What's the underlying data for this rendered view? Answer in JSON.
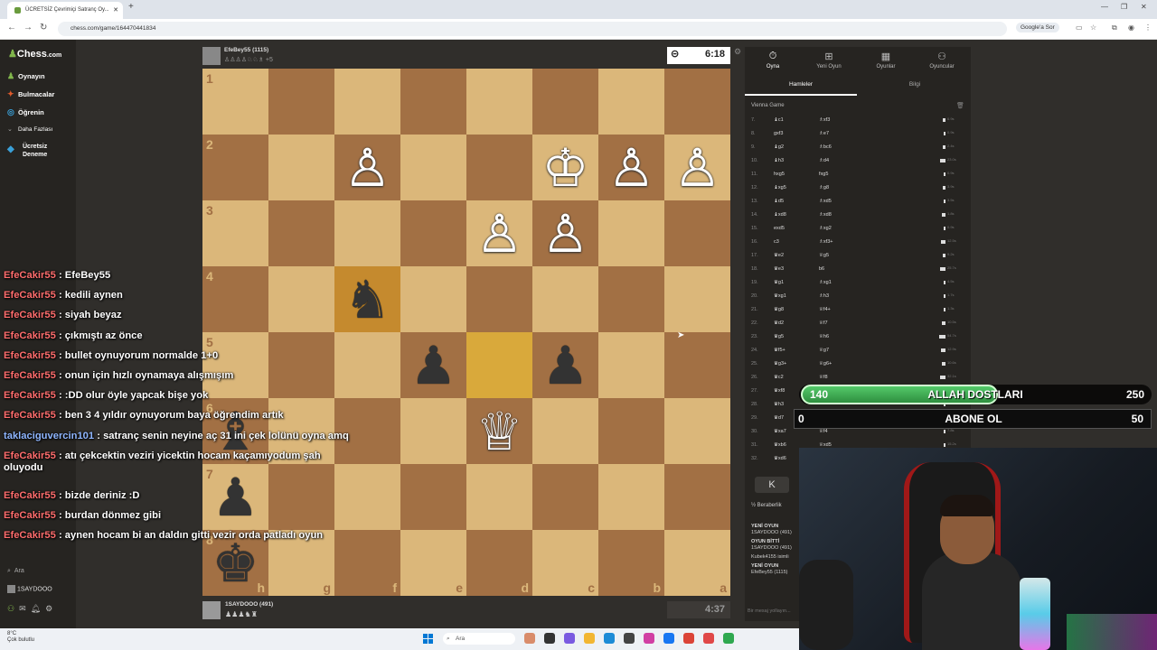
{
  "browser": {
    "tab_title": "ÜCRETSİZ Çevrimiçi Satranç Oy...",
    "url": "chess.com/game/164470441834",
    "google_sor": "Google'a Sor"
  },
  "sidebar": {
    "logo": "Chess",
    "logo_suffix": ".com",
    "items": [
      {
        "label": "Oynayın",
        "icon": "play-icon",
        "color": "#81b64c"
      },
      {
        "label": "Bulmacalar",
        "icon": "puzzle-icon",
        "color": "#e05a2b"
      },
      {
        "label": "Öğrenin",
        "icon": "learn-icon",
        "color": "#3aa0d8"
      },
      {
        "label": "Daha Fazlası",
        "icon": "chevron-down-icon",
        "color": "#aaa"
      }
    ],
    "trial_line1": "Ücretsiz",
    "trial_line2": "Deneme",
    "search": "Ara",
    "user": "1SAYDOOO"
  },
  "game": {
    "top_player": {
      "name": "EfeBey55 (1115)",
      "captured": "♙♙♙♙♘♘♗ +5"
    },
    "top_clock": "6:18",
    "bottom_player": {
      "name": "1SAYDOOO (491)",
      "captured": "♟♟♟♞♜"
    },
    "bottom_clock": "4:37",
    "ranks": [
      "1",
      "2",
      "3",
      "4",
      "5",
      "6",
      "7",
      "8"
    ],
    "files": [
      "h",
      "g",
      "f",
      "e",
      "d",
      "c",
      "b",
      "a"
    ],
    "pieces": {
      "1,2": {
        "g": "♙",
        "c": "w"
      },
      "1,5": {
        "g": "♔",
        "c": "w"
      },
      "1,6": {
        "g": "♙",
        "c": "w"
      },
      "1,7": {
        "g": "♙",
        "c": "w"
      },
      "2,4": {
        "g": "♙",
        "c": "w"
      },
      "2,5": {
        "g": "♙",
        "c": "w"
      },
      "3,2": {
        "g": "♞",
        "c": "b"
      },
      "4,3": {
        "g": "♟",
        "c": "b"
      },
      "4,5": {
        "g": "♟",
        "c": "b"
      },
      "5,0": {
        "g": "♝",
        "c": "b"
      },
      "5,4": {
        "g": "♕",
        "c": "w"
      },
      "6,0": {
        "g": "♟",
        "c": "b"
      },
      "7,0": {
        "g": "♚",
        "c": "b"
      }
    },
    "highlights": {
      "3,2": "hl",
      "4,4": "hl"
    }
  },
  "chat": [
    {
      "user": "EfeCakir55",
      "msg": " : EfeBey55",
      "utype": "red"
    },
    {
      "user": "EfeCakir55",
      "msg": " : kedili aynen",
      "utype": "red"
    },
    {
      "user": "EfeCakir55",
      "msg": " : siyah beyaz",
      "utype": "red"
    },
    {
      "user": "EfeCakir55",
      "msg": " : çıkmıştı az önce",
      "utype": "red"
    },
    {
      "user": "EfeCakir55",
      "msg": " : bullet oynuyorum normalde 1+0",
      "utype": "red"
    },
    {
      "user": "EfeCakir55",
      "msg": " : onun için hızlı oynamaya alışmışım",
      "utype": "red"
    },
    {
      "user": "EfeCakir55",
      "msg": " : :DD olur öyle yapcak bişe yok",
      "utype": "red"
    },
    {
      "user": "EfeCakir55",
      "msg": " : ben 3 4 yıldır oynuyorum baya öğrendim artık",
      "utype": "red"
    },
    {
      "user": "taklaciguvercin101",
      "msg": " : satranç senin neyine aç 31 ini çek lolünü oyna amq",
      "utype": "blue"
    },
    {
      "user": "EfeCakir55",
      "msg": " : atı çekcektin veziri yicektin hocam kaçamıyodum şah",
      "utype": "red"
    },
    {
      "user": "EfeCakir55",
      "msg": " : bizde deriniz :D",
      "utype": "red"
    },
    {
      "user": "EfeCakir55",
      "msg": " : burdan dönmez gibi",
      "utype": "red"
    },
    {
      "user": "EfeCakir55",
      "msg": " : aynen hocam bi an daldın gitti vezir orda patladı oyun",
      "utype": "red"
    }
  ],
  "chat_wrap": "oluyodu",
  "panel": {
    "tabs": [
      {
        "label": "Oyna",
        "icon": "clock-icon"
      },
      {
        "label": "Yeni Oyun",
        "icon": "plus-icon"
      },
      {
        "label": "Oyunlar",
        "icon": "grid-icon"
      },
      {
        "label": "Oyuncular",
        "icon": "players-icon"
      }
    ],
    "subtabs": [
      "Hamleler",
      "Bilgi"
    ],
    "opening": "Vienna Game",
    "moves": [
      {
        "n": "7.",
        "w": "♝c1",
        "b": "♗xf3",
        "t1": "6.9s",
        "t2": "7.6s",
        "bar": 3
      },
      {
        "n": "8.",
        "w": "gxf3",
        "b": "♗e7",
        "t1": "0.9s",
        "t2": "4.8s",
        "bar": 2
      },
      {
        "n": "9.",
        "w": "♝g2",
        "b": "♗bc6",
        "t1": "2.4s",
        "t2": "4.6s",
        "bar": 3
      },
      {
        "n": "10.",
        "w": "♝h3",
        "b": "♗d4",
        "t1": "23.0s",
        "t2": "11.0s",
        "bar": 6
      },
      {
        "n": "11.",
        "w": "hxg5",
        "b": "fxg5",
        "t1": "0.9s",
        "t2": "3.6s",
        "bar": 2
      },
      {
        "n": "12.",
        "w": "♝xg5",
        "b": "♗g8",
        "t1": "3.9s",
        "t2": "11.5s",
        "bar": 3
      },
      {
        "n": "13.",
        "w": "♝d5",
        "b": "♗xd5",
        "t1": "3.5s",
        "t2": "3.1s",
        "bar": 2
      },
      {
        "n": "14.",
        "w": "♝xd8",
        "b": "♗xd8",
        "t1": "1.8s",
        "t2": "17.8s",
        "bar": 4
      },
      {
        "n": "15.",
        "w": "exd5",
        "b": "♗xg2",
        "t1": "0.9s",
        "t2": "3.6s",
        "bar": 2
      },
      {
        "n": "16.",
        "w": "c3",
        "b": "♗xf3+",
        "t1": "12.5s",
        "t2": "4.2s",
        "bar": 5
      },
      {
        "n": "17.",
        "w": "♛e2",
        "b": "♕g5",
        "t1": "9.2s",
        "t2": "44.0s",
        "bar": 3
      },
      {
        "n": "18.",
        "w": "♛e3",
        "b": "b6",
        "t1": "25.7s",
        "t2": "2.7s",
        "bar": 6
      },
      {
        "n": "19.",
        "w": "♛g1",
        "b": "♗xg1",
        "t1": "4.5s",
        "t2": "17.5s",
        "bar": 2
      },
      {
        "n": "20.",
        "w": "♛xg1",
        "b": "♗h3",
        "t1": "1.7s",
        "t2": "4.6s",
        "bar": 2
      },
      {
        "n": "21.",
        "w": "♛g8",
        "b": "♕f4+",
        "t1": "1.3s",
        "t2": "37.5s",
        "bar": 2
      },
      {
        "n": "22.",
        "w": "♛d2",
        "b": "♕f7",
        "t1": "10.5s",
        "t2": "6.6s",
        "bar": 4
      },
      {
        "n": "23.",
        "w": "♛g5",
        "b": "♕h6",
        "t1": "54.7s",
        "t2": "8.8s",
        "bar": 7
      },
      {
        "n": "24.",
        "w": "♛f5+",
        "b": "♕g7",
        "t1": "12.9s",
        "t2": "2.0s",
        "bar": 5
      },
      {
        "n": "25.",
        "w": "♛g3+",
        "b": "♕g6+",
        "t1": "10.6s",
        "t2": "17.6s",
        "bar": 4
      },
      {
        "n": "26.",
        "w": "♛c2",
        "b": "♕f8",
        "t1": "32.1s",
        "t2": "4.1s",
        "bar": 6
      },
      {
        "n": "27.",
        "w": "♛xf8",
        "b": "",
        "t1": "",
        "t2": "",
        "bar": 2
      },
      {
        "n": "28.",
        "w": "♛h3",
        "b": "",
        "t1": "",
        "t2": "",
        "bar": 2
      },
      {
        "n": "29.",
        "w": "♛d7",
        "b": "♕h8",
        "t1": "",
        "t2": "",
        "bar": 2
      },
      {
        "n": "30.",
        "w": "♛xa7",
        "b": "♕f4",
        "t1": "7.8s",
        "t2": "",
        "bar": 2
      },
      {
        "n": "31.",
        "w": "♛xb6",
        "b": "♕xd5",
        "t1": "15.2s",
        "t2": "",
        "bar": 2
      },
      {
        "n": "32.",
        "w": "♛xd6",
        "b": "",
        "t1": "",
        "t2": "",
        "bar": 2
      }
    ],
    "k_button": "K",
    "draw_label": "½  Beraberlik",
    "feed": [
      {
        "h": "YENİ OYUN",
        "t": "1SAYDOOO (491)"
      },
      {
        "h": "OYUN BİTTİ",
        "t": "1SAYDOOO (491)"
      },
      {
        "h": "",
        "t": "Kubek4155 isimli"
      },
      {
        "h": "YENİ OYUN",
        "t": "EfeBey55 (1115)"
      }
    ],
    "message_placeholder": "Bir mesaj yollayın..."
  },
  "overlay": {
    "bar1_left": "140",
    "bar1_mid": "ALLAH DOSTLARI",
    "bar1_right": "250",
    "bar1_progress": 0.56,
    "bar2_left": "0",
    "bar2_mid": "ABONE OL",
    "bar2_right": "50",
    "bar2_progress": 0
  },
  "taskbar": {
    "weather_temp": "8°C",
    "weather_desc": "Çok bulutlu",
    "search": "Ara"
  }
}
